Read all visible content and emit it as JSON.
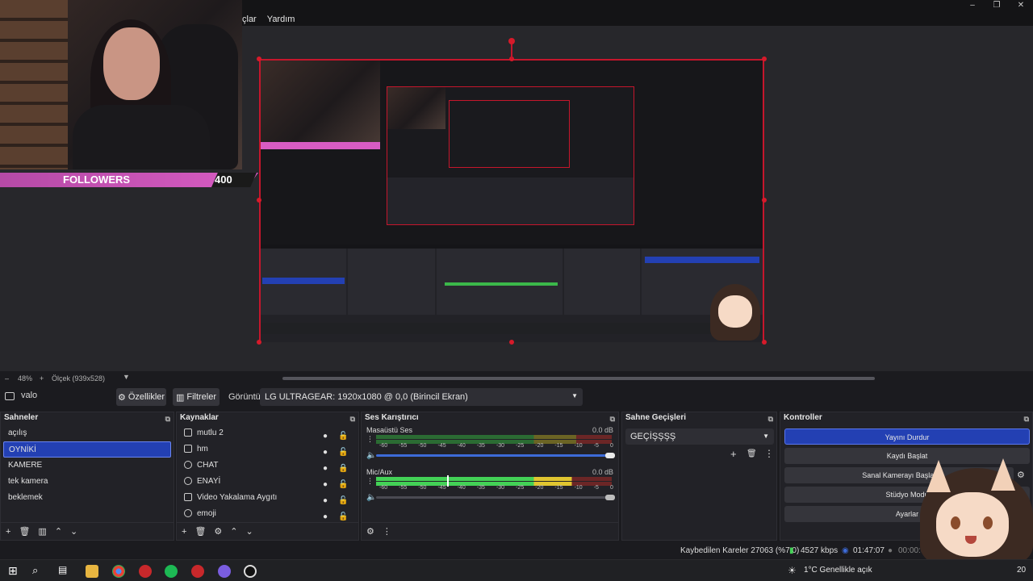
{
  "menu": {
    "items": [
      "çlar",
      "Yardım"
    ]
  },
  "window_controls": [
    "–",
    "❐",
    "✕"
  ],
  "webcam": {
    "followers_label": "FOLLOWERS",
    "followers_count": "400"
  },
  "zoom": {
    "minus": "–",
    "level": "48%",
    "plus": "+",
    "mode": "Ölçek (939x528)"
  },
  "source_toolbar": {
    "source_name": "valo",
    "properties_label": "Özellikler",
    "filters_label": "Filtreler",
    "display_label": "Görüntü",
    "display_value": "LG ULTRAGEAR: 1920x1080 @ 0,0 (Birincil Ekran)"
  },
  "scenes": {
    "title": "Sahneler",
    "items": [
      "açılış",
      "OYNİKİ",
      "KAMERE",
      "tek kamera",
      "beklemek"
    ],
    "selected_index": 1
  },
  "sources": {
    "title": "Kaynaklar",
    "items": [
      {
        "label": "mutlu 2",
        "icon": "image-icon",
        "locked": false
      },
      {
        "label": "hm",
        "icon": "image-icon",
        "locked": false
      },
      {
        "label": "CHAT",
        "icon": "browser-icon",
        "locked": true
      },
      {
        "label": "ENAYİ",
        "icon": "browser-icon",
        "locked": false
      },
      {
        "label": "Video Yakalama Aygıtı",
        "icon": "camera-icon",
        "locked": false
      },
      {
        "label": "emoji",
        "icon": "browser-icon",
        "locked": false
      }
    ]
  },
  "mixer": {
    "title": "Ses Karıştırıcı",
    "channels": [
      {
        "name": "Masaüstü Ses",
        "db": "0.0 dB",
        "level": 0.0,
        "volume": 1.0
      },
      {
        "name": "Mic/Aux",
        "db": "0.0 dB",
        "level": 0.7,
        "volume": 1.0
      }
    ],
    "scale": [
      "-60",
      "-55",
      "-50",
      "-45",
      "-40",
      "-35",
      "-30",
      "-25",
      "-20",
      "-15",
      "-10",
      "-5",
      "0"
    ]
  },
  "transitions": {
    "title": "Sahne Geçişleri",
    "selected": "GEÇİŞŞŞŞ"
  },
  "controls": {
    "title": "Kontroller",
    "stop_stream": "Yayını Durdur",
    "start_record": "Kaydı Başlat",
    "virtual_cam": "Sanal Kamerayı Başlat",
    "studio_mode": "Stüdyo Modu",
    "settings": "Ayarlar"
  },
  "status": {
    "dropped_frames": "Kaybedilen Kareler 27063 (%7.0)",
    "bitrate": "4527 kbps",
    "stream_time": "01:47:07",
    "record_time": "00:00:00"
  },
  "taskbar": {
    "weather": "1°C  Genellikle açık",
    "clock_partial": "20"
  },
  "colors": {
    "accent": "#2340b3",
    "frame": "#c5162c",
    "follower_bar": "#d85cc3"
  }
}
